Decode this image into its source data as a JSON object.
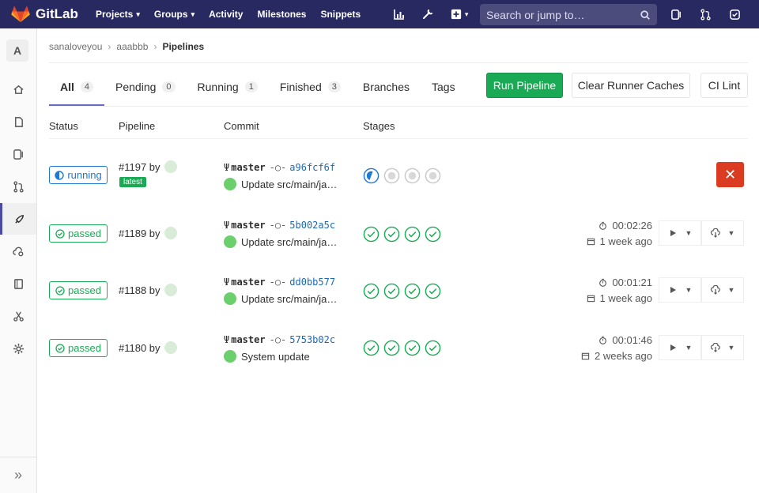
{
  "brand": {
    "name": "GitLab"
  },
  "nav": {
    "links": [
      "Projects",
      "Groups",
      "Activity",
      "Milestones",
      "Snippets"
    ],
    "search_placeholder": "Search or jump to…"
  },
  "sidebar": {
    "avatar_letter": "A"
  },
  "breadcrumb": {
    "items": [
      "sanaloveyou",
      "aaabbb"
    ],
    "current": "Pipelines"
  },
  "tabs": [
    {
      "label": "All",
      "count": "4"
    },
    {
      "label": "Pending",
      "count": "0"
    },
    {
      "label": "Running",
      "count": "1"
    },
    {
      "label": "Finished",
      "count": "3"
    },
    {
      "label": "Branches",
      "count": ""
    },
    {
      "label": "Tags",
      "count": ""
    }
  ],
  "buttons": {
    "run": "Run Pipeline",
    "clear": "Clear Runner Caches",
    "lint": "CI Lint"
  },
  "table": {
    "headers": {
      "status": "Status",
      "pipeline": "Pipeline",
      "commit": "Commit",
      "stages": "Stages"
    },
    "rows": [
      {
        "status": "running",
        "id": "#1197 by",
        "latest": "latest",
        "branch": "master",
        "sha": "a96fcf6f",
        "message": "Update src/main/ja…",
        "stages": [
          "running",
          "created",
          "created",
          "created"
        ],
        "duration": "",
        "finished": ""
      },
      {
        "status": "passed",
        "id": "#1189 by",
        "latest": "",
        "branch": "master",
        "sha": "5b002a5c",
        "message": "Update src/main/ja…",
        "stages": [
          "success",
          "success",
          "success",
          "success"
        ],
        "duration": "00:02:26",
        "finished": "1 week ago"
      },
      {
        "status": "passed",
        "id": "#1188 by",
        "latest": "",
        "branch": "master",
        "sha": "dd0bb577",
        "message": "Update src/main/ja…",
        "stages": [
          "success",
          "success",
          "success",
          "success"
        ],
        "duration": "00:01:21",
        "finished": "1 week ago"
      },
      {
        "status": "passed",
        "id": "#1180 by",
        "latest": "",
        "branch": "master",
        "sha": "5753b02c",
        "message": "System update",
        "stages": [
          "success",
          "success",
          "success",
          "success"
        ],
        "duration": "00:01:46",
        "finished": "2 weeks ago"
      }
    ]
  },
  "colors": {
    "navbar": "#292961",
    "success": "#1aaa55",
    "running": "#1f78d1",
    "danger": "#db3b21"
  }
}
